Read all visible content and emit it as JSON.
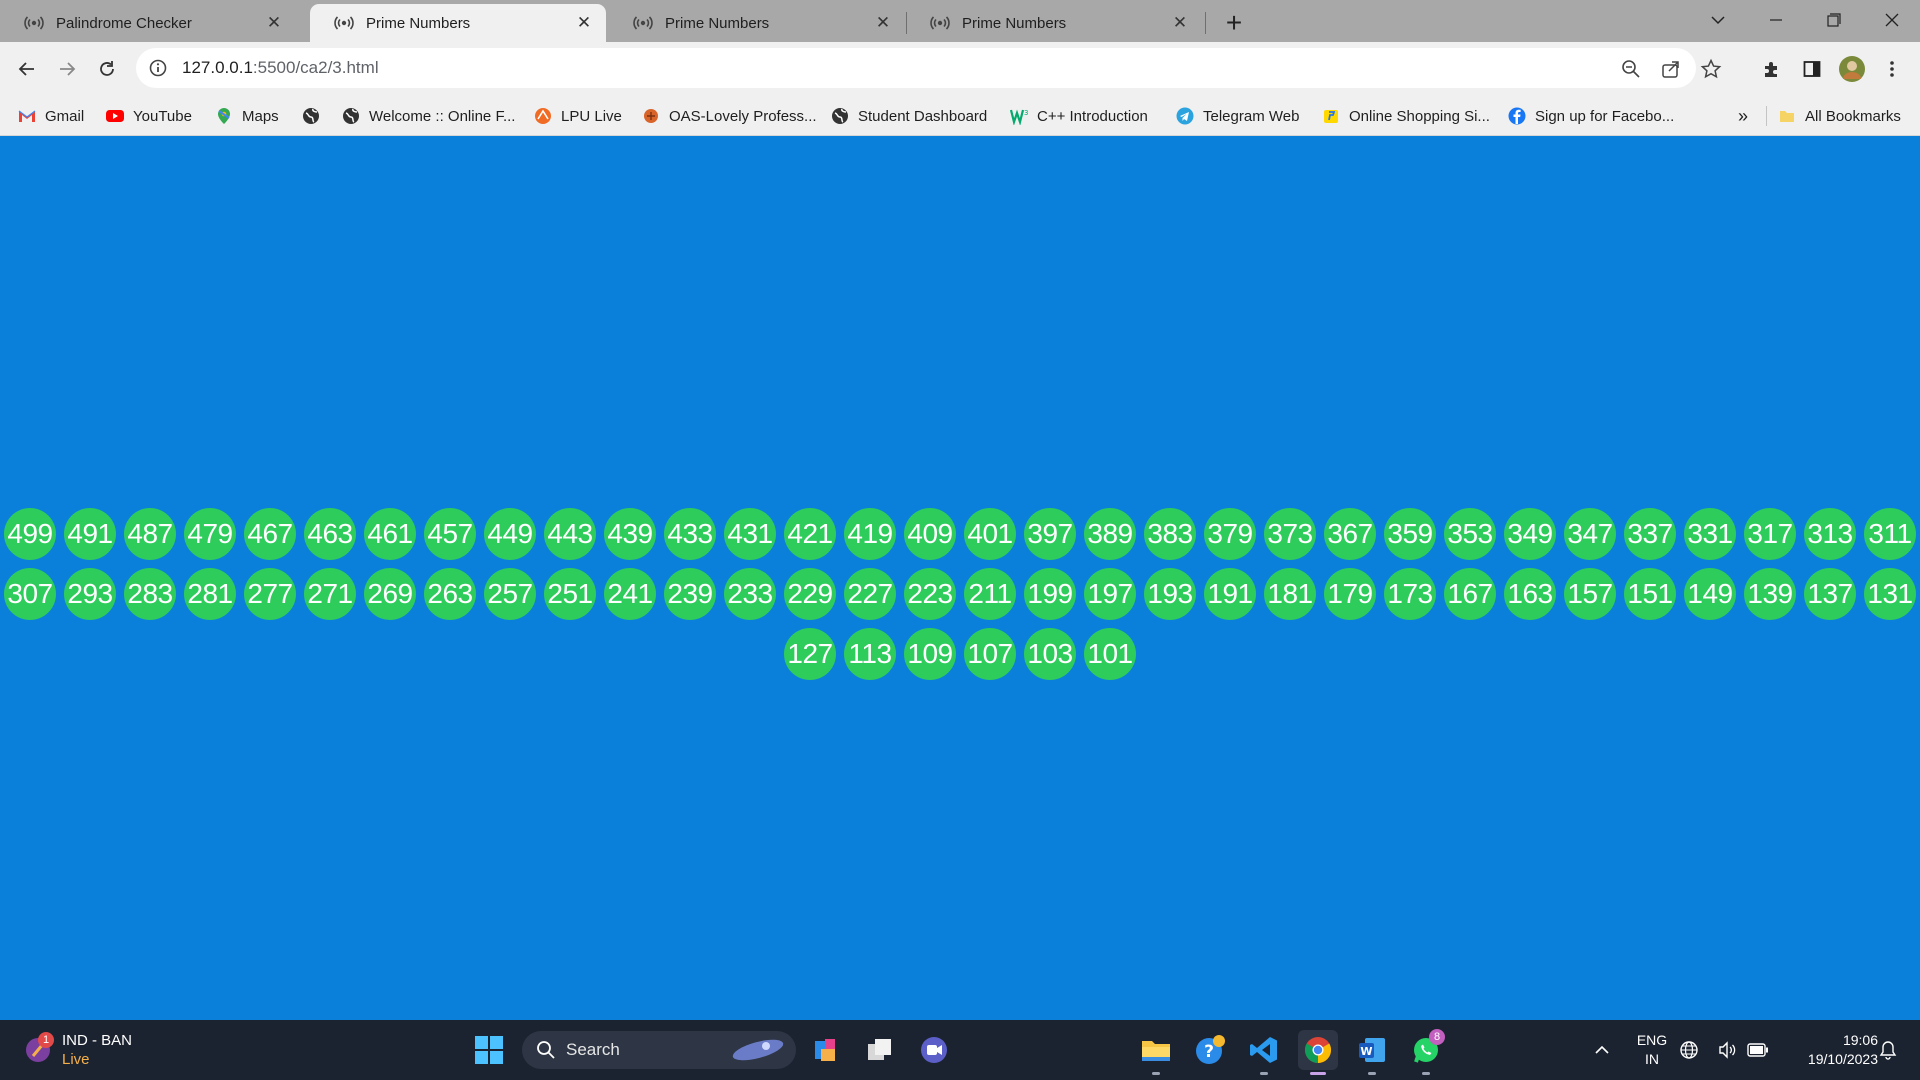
{
  "browser": {
    "tabs": [
      {
        "title": "Palindrome Checker"
      },
      {
        "title": "Prime Numbers"
      },
      {
        "title": "Prime Numbers"
      },
      {
        "title": "Prime Numbers"
      }
    ],
    "close_glyph": "✕",
    "new_tab_glyph": "+",
    "address": {
      "host": "127.0.0.1",
      "path": ":5500/ca2/3.html"
    },
    "bookmarks": [
      {
        "label": "Gmail",
        "icon": "gmail-icon"
      },
      {
        "label": "YouTube",
        "icon": "youtube-icon"
      },
      {
        "label": "Maps",
        "icon": "maps-icon"
      },
      {
        "label": "",
        "icon": "globe-icon"
      },
      {
        "label": "Welcome :: Online F...",
        "icon": "globe-icon"
      },
      {
        "label": "LPU Live",
        "icon": "lpu-live-icon"
      },
      {
        "label": "OAS-Lovely Profess...",
        "icon": "lpu-icon"
      },
      {
        "label": "Student Dashboard",
        "icon": "globe-icon"
      },
      {
        "label": "C++ Introduction",
        "icon": "w3schools-icon"
      },
      {
        "label": "Telegram Web",
        "icon": "telegram-icon"
      },
      {
        "label": "Online Shopping Si...",
        "icon": "flipkart-icon"
      },
      {
        "label": "Sign up for Facebo...",
        "icon": "facebook-icon"
      }
    ],
    "overflow_glyph": "»",
    "all_bookmarks_label": "All Bookmarks"
  },
  "page": {
    "primes": [
      "499",
      "491",
      "487",
      "479",
      "467",
      "463",
      "461",
      "457",
      "449",
      "443",
      "439",
      "433",
      "431",
      "421",
      "419",
      "409",
      "401",
      "397",
      "389",
      "383",
      "379",
      "373",
      "367",
      "359",
      "353",
      "349",
      "347",
      "337",
      "331",
      "317",
      "313",
      "311",
      "307",
      "293",
      "283",
      "281",
      "277",
      "271",
      "269",
      "263",
      "257",
      "251",
      "241",
      "239",
      "233",
      "229",
      "227",
      "223",
      "211",
      "199",
      "197",
      "193",
      "191",
      "181",
      "179",
      "173",
      "167",
      "163",
      "157",
      "151",
      "149",
      "139",
      "137",
      "131",
      "127",
      "113",
      "109",
      "107",
      "103",
      "101"
    ],
    "background_color": "#0b80db",
    "circle_color": "#2ecc5b"
  },
  "taskbar": {
    "weather": {
      "line1": "IND - BAN",
      "line2": "Live",
      "badge": "1"
    },
    "search_label": "Search",
    "whatsapp_badge": "8",
    "language": {
      "line1": "ENG",
      "line2": "IN"
    },
    "clock": {
      "time": "19:06",
      "date": "19/10/2023"
    }
  }
}
